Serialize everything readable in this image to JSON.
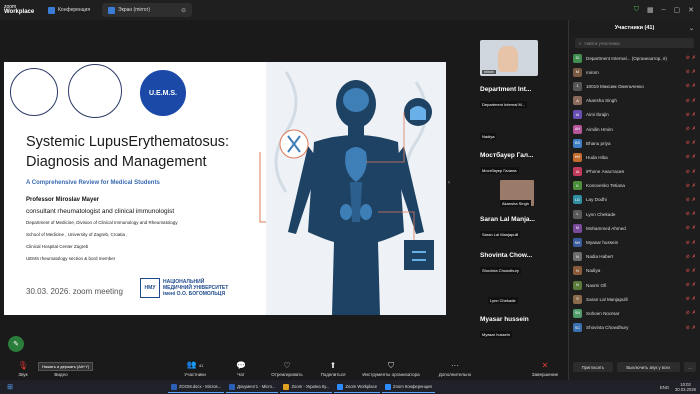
{
  "titlebar": {
    "app_name_top": "zoom",
    "app_name_bottom": "Workplace",
    "tab1": "Конференция",
    "tab2": "Экран (mirror)",
    "tab2_close": "⊖"
  },
  "slide": {
    "eu_badge": "U.E.M.S.",
    "title_line1": "Systemic LupusErythematosus:",
    "title_line2": "Diagnosis and Management",
    "subtitle": "A Comprehensive Review for Medical Students",
    "professor": "Professor Miroslav Mayer",
    "role": "consultant rheumatologist and clinical immunologist",
    "lines": [
      "Department of Medicine, Division of Clinical Immunology and Rheumatology",
      "School of Medicine , University of Zagreb, Croatia ,",
      "Clinical Hospital Center Zagreb",
      "UEMS rheumatology section & bord member"
    ],
    "date": "30.03. 2026. zoom meeting",
    "uni_logo": "НМУ",
    "uni_line1": "НАЦІОНАЛЬНИЙ",
    "uni_line2": "МЕДИЧНИЙ УНІВЕРСИТЕТ",
    "uni_line3": "імені О.О. БОГОМОЛЬЦЯ"
  },
  "video": {
    "name": "mirom"
  },
  "tiles": [
    {
      "name": "Department Int...",
      "tag": "Department Internal M..."
    },
    {
      "name": "Мостбауер Гал...",
      "tag": "Мостбауер Галина"
    },
    {
      "name": "Saran Lal Manja...",
      "tag": "Saran Lal Manjapulli"
    },
    {
      "name": "Shovinta Chow...",
      "tag": "Shovinta Chowdhury"
    },
    {
      "name": "Myasar hussein",
      "tag": "Myasar hussein"
    }
  ],
  "tile_extra": {
    "nadiya": "Nadiya",
    "akansha": "Akansha Singh",
    "lynn": "Lynn Chekade"
  },
  "panel": {
    "title": "Участники (41)",
    "search_placeholder": "Найти участника",
    "participants": [
      {
        "initials": "DI",
        "name": "Department Internal... (Организатор, я)",
        "color": "#3f8d4f"
      },
      {
        "initials": "M",
        "name": "mirom",
        "color": "#7b5a44"
      },
      {
        "initials": "1",
        "name": "10019 Максим Омельченко",
        "color": "#555555"
      },
      {
        "initials": "A",
        "name": "Akansha Singh",
        "color": "#8a6a5c"
      },
      {
        "initials": "AI",
        "name": "Aimi Ibrajin",
        "color": "#6a4fb3"
      },
      {
        "initials": "AH",
        "name": "Aimilin Hmim",
        "color": "#b5569a"
      },
      {
        "initials": "BS",
        "name": "Bhanu priya",
        "color": "#3f7dc4"
      },
      {
        "initials": "HH",
        "name": "Huda Hiba",
        "color": "#c26b2e"
      },
      {
        "initials": "IA",
        "name": "iPhone Анастасия",
        "color": "#c23a5b"
      },
      {
        "initials": "K",
        "name": "Konovenko Tetiana",
        "color": "#4c8f3a"
      },
      {
        "initials": "LD",
        "name": "Lay Dodhi",
        "color": "#2f8fa0"
      },
      {
        "initials": "L",
        "name": "Lynn Chekade",
        "color": "#5a5a5a"
      },
      {
        "initials": "M",
        "name": "Mohammed Ahmed",
        "color": "#7a4a9a"
      },
      {
        "initials": "NH",
        "name": "Myasar hussein",
        "color": "#3b5c9c"
      },
      {
        "initials": "N",
        "name": "Nadia Habert",
        "color": "#6e6e6e"
      },
      {
        "initials": "N",
        "name": "Nadiya",
        "color": "#8b5a3a"
      },
      {
        "initials": "N",
        "name": "Naomi Ofi",
        "color": "#5a7a3a"
      },
      {
        "initials": "S",
        "name": "Saran Lal Manjapulli",
        "color": "#8a6a4a"
      },
      {
        "initials": "SN",
        "name": "Sohoen Noorsar",
        "color": "#4f9a6a"
      },
      {
        "initials": "SC",
        "name": "Shovinta Chowdhury",
        "color": "#3a6fb0"
      }
    ],
    "invite_label": "Пригласить",
    "mute_all_label": "Выключить звук у всех",
    "more_label": "..."
  },
  "toolbar": {
    "mute_message": "Нажать и держать (Alt+Y)",
    "mic": "Звук",
    "video": "Видео",
    "participants": "Участники",
    "participants_count": "41",
    "chat": "Чат",
    "react": "Отреагировать",
    "share": "Поделиться",
    "host_tools": "Инструменты организатора",
    "more": "Дополнительно",
    "end": "Завершение"
  },
  "taskbar": {
    "items": [
      {
        "label": "ZOOM.docx - Micros...",
        "color": "#2b5fb5"
      },
      {
        "label": "Документ1 - Micro...",
        "color": "#2b5fb5"
      },
      {
        "label": "Zoom - Україна Ку...",
        "color": "#e0a020"
      },
      {
        "label": "Zoom Workplace",
        "color": "#2d8cff"
      },
      {
        "label": "Zoom Конференция",
        "color": "#2d8cff"
      }
    ],
    "lang": "ENG",
    "time": "10:03",
    "date": "30.03.2026"
  }
}
